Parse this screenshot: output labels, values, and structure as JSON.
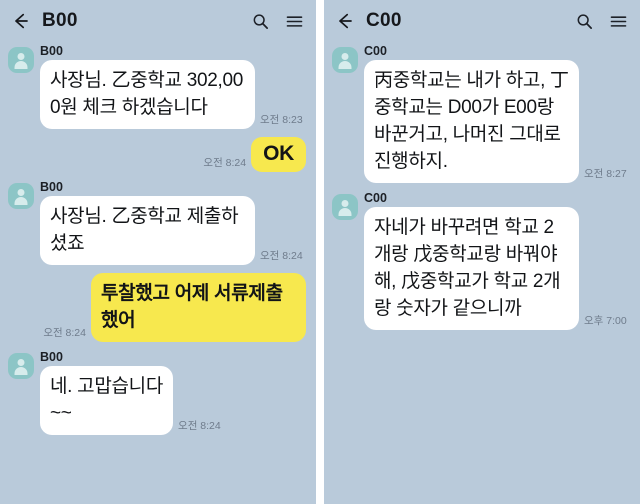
{
  "panels": [
    {
      "id": "left",
      "header": {
        "back_icon": "back-arrow-icon",
        "title": "B00",
        "search_icon": "search-icon",
        "menu_icon": "hamburger-menu-icon"
      },
      "messages": [
        {
          "type": "incoming",
          "sender": "B00",
          "text": "사장님. 乙중학교 302,000원 체크 하겠습니다",
          "time": "오전 8:23"
        },
        {
          "type": "outgoing",
          "text": "OK",
          "time": "오전 8:24",
          "style": "ok"
        },
        {
          "type": "incoming",
          "sender": "B00",
          "text": "사장님. 乙중학교 제출하셨죠",
          "time": "오전 8:24"
        },
        {
          "type": "outgoing",
          "text": "투찰했고 어제 서류제출했어",
          "time": "오전 8:24"
        },
        {
          "type": "incoming",
          "sender": "B00",
          "text": "네. 고맙습니다\n~~",
          "time": "오전 8:24"
        }
      ]
    },
    {
      "id": "right",
      "header": {
        "back_icon": "back-arrow-icon",
        "title": "C00",
        "search_icon": "search-icon",
        "menu_icon": "hamburger-menu-icon"
      },
      "messages": [
        {
          "type": "incoming",
          "sender": "C00",
          "text": "丙중학교는 내가 하고, 丁중학교는 D00가 E00랑 바꾼거고, 나머진 그대로 진행하지.",
          "time": "오전 8:27"
        },
        {
          "type": "incoming",
          "sender": "C00",
          "text": "자네가 바꾸려면 학교 2개랑 戊중학교랑 바꿔야해, 戊중학교가 학교 2개랑 숫자가 같으니까",
          "time": "오후 7:00"
        }
      ]
    }
  ],
  "colors": {
    "chat_background": "#b9cada",
    "incoming_bubble": "#ffffff",
    "outgoing_bubble": "#f7e84e",
    "avatar": "#8cc5c6",
    "timestamp_text": "#6f7c8c",
    "header_text": "#16181c"
  }
}
